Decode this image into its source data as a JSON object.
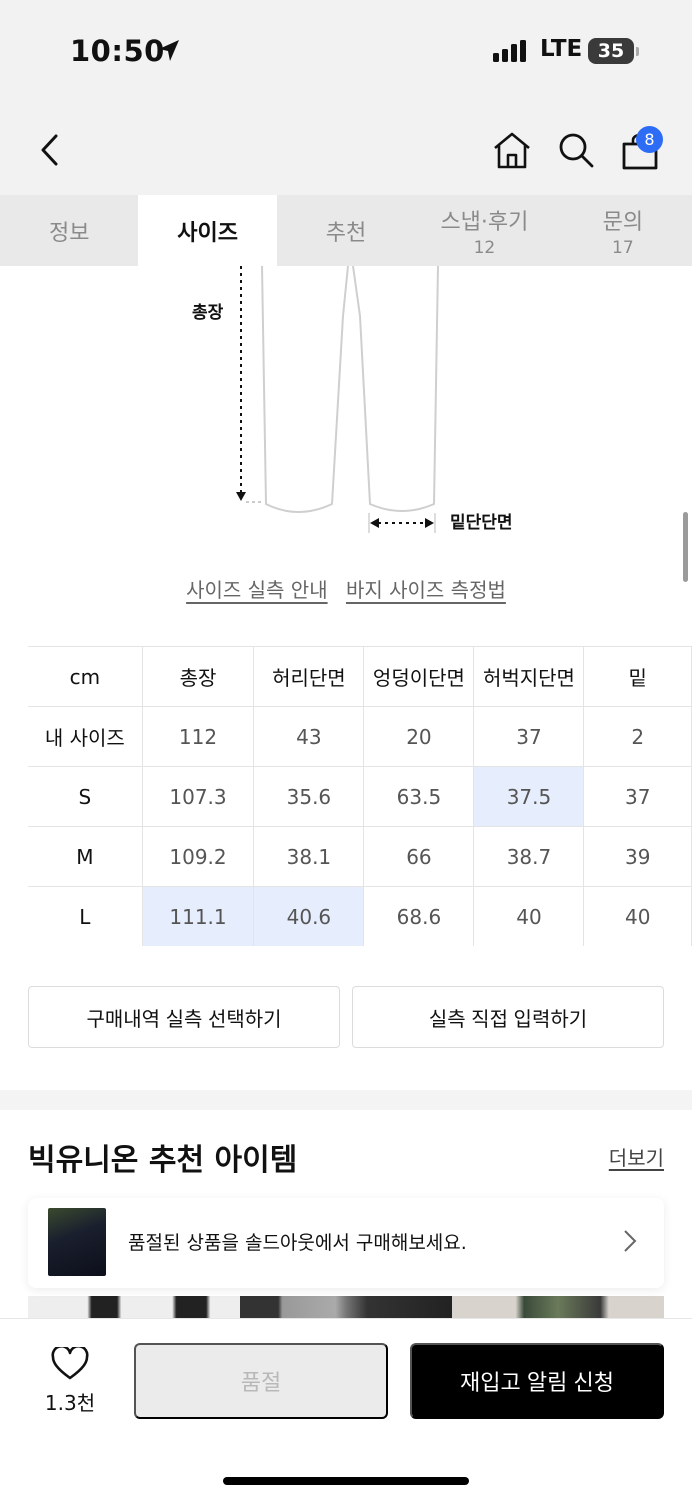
{
  "status_bar": {
    "time": "10:50",
    "network": "LTE",
    "battery": "35"
  },
  "header": {
    "cart_count": "8"
  },
  "tabs": [
    {
      "label": "정보",
      "count": ""
    },
    {
      "label": "사이즈",
      "count": ""
    },
    {
      "label": "추천",
      "count": ""
    },
    {
      "label": "스냅·후기",
      "count": "12"
    },
    {
      "label": "문의",
      "count": "17"
    }
  ],
  "diagram": {
    "length_label": "총장",
    "hem_label": "밑단단면"
  },
  "guide_links": {
    "size_guide": "사이즈 실측 안내",
    "measure_guide": "바지 사이즈 측정법"
  },
  "size_table": {
    "headers": [
      "cm",
      "총장",
      "허리단면",
      "엉덩이단면",
      "허벅지단면",
      "밑"
    ],
    "rows": [
      {
        "label": "내 사이즈",
        "values": [
          "112",
          "43",
          "20",
          "37",
          "2"
        ]
      },
      {
        "label": "S",
        "values": [
          "107.3",
          "35.6",
          "63.5",
          "37.5",
          "37"
        ]
      },
      {
        "label": "M",
        "values": [
          "109.2",
          "38.1",
          "66",
          "38.7",
          "39"
        ]
      },
      {
        "label": "L",
        "values": [
          "111.1",
          "40.6",
          "68.6",
          "40",
          "40"
        ]
      }
    ]
  },
  "buttons": {
    "purchase_history": "구매내역 실측 선택하기",
    "manual_input": "실측 직접 입력하기"
  },
  "recommend": {
    "title": "빅유니온 추천 아이템",
    "more": "더보기",
    "soldout_text": "품절된 상품을 솔드아웃에서 구매해보세요."
  },
  "bottom": {
    "likes": "1.3천",
    "soldout_button": "품절",
    "restock_button": "재입고 알림 신청"
  },
  "colors": {
    "accent_blue": "#2d6df6",
    "highlight_cell": "#e6edfc"
  }
}
